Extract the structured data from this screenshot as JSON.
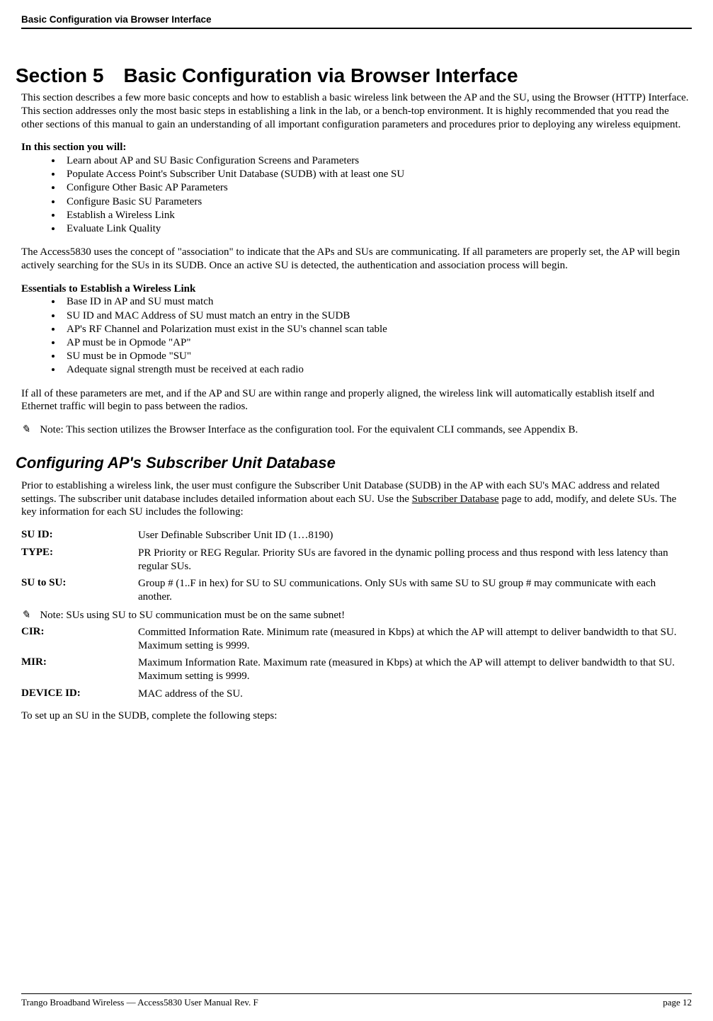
{
  "header": {
    "title": "Basic Configuration via Browser Interface"
  },
  "section": {
    "number": "Section 5",
    "title": "Basic Configuration via Browser Interface"
  },
  "intro": "This section describes a few more basic concepts and how to establish a basic wireless link between the AP and the SU, using the Browser (HTTP) Interface.  This section addresses only the most basic steps in establishing a link in the lab, or a bench-top environment.  It is highly recommended that you read the other sections of this manual to gain an understanding of all important configuration parameters and procedures prior to deploying any wireless equipment.",
  "in_this_section_label": "In this section you will:",
  "in_this_section": [
    "Learn about AP and SU Basic Configuration Screens and Parameters",
    "Populate Access Point's Subscriber Unit Database (SUDB) with at least one SU",
    "Configure Other Basic AP Parameters",
    "Configure Basic SU Parameters",
    "Establish a Wireless Link",
    "Evaluate Link Quality"
  ],
  "para2": "The Access5830 uses the concept of \"association\" to indicate that the APs and SUs are communicating.  If all parameters are properly set, the AP will begin actively searching for the SUs in its SUDB.  Once an active SU is detected, the authentication and association process will begin.",
  "essentials_label": "Essentials to Establish a Wireless Link",
  "essentials": [
    "Base ID in AP and SU must match",
    "SU ID and MAC Address of SU must match an entry in the SUDB",
    "AP's RF Channel and Polarization must exist in the SU's channel scan table",
    "AP must be in Opmode \"AP\"",
    "SU must be in Opmode \"SU\"",
    "Adequate signal strength must be received at each radio"
  ],
  "para3": "If all of these parameters are met, and if the AP and SU are within range and properly aligned, the wireless link will automatically establish itself and Ethernet traffic will begin to pass between the radios.",
  "note1_prefix": "Note:  ",
  "note1_body": "This section utilizes the Browser Interface as the configuration tool.  For the equivalent CLI commands, see Appendix B.",
  "pencil_glyph": "✎",
  "subheading": "Configuring AP's Subscriber Unit Database",
  "sudb_intro_pre": "Prior to establishing a wireless link, the user must configure the Subscriber Unit Database (SUDB) in the AP with each SU's MAC address and related settings.  The subscriber unit database includes detailed information about each SU.  Use the ",
  "sudb_intro_underline": "Subscriber Database",
  "sudb_intro_post": " page to add, modify, and delete SUs.  The key information for each SU includes the following:",
  "defs": {
    "su_id": {
      "term": "SU ID:",
      "desc": "User Definable Subscriber Unit ID (1…8190)"
    },
    "type": {
      "term": "TYPE:",
      "desc": "PR Priority or REG Regular.  Priority SUs are favored in the dynamic polling process and thus respond with less latency than regular SUs."
    },
    "su_to_su": {
      "term": "SU to SU:",
      "desc": "Group # (1..F in hex) for SU to SU communications.  Only SUs with same SU to SU group # may communicate with each another."
    },
    "cir": {
      "term": "CIR:",
      "desc": "Committed Information Rate. Minimum rate (measured in Kbps) at which the AP will attempt to deliver bandwidth to that SU.  Maximum setting is 9999."
    },
    "mir": {
      "term": "MIR:",
      "desc": "Maximum Information Rate. Maximum rate (measured in Kbps) at which the AP will attempt to deliver bandwidth to that SU.  Maximum setting is 9999."
    },
    "device_id": {
      "term": "DEVICE ID:",
      "desc": "MAC address of the SU."
    }
  },
  "note2_prefix": "Note: ",
  "note2_body": "SUs using SU to SU communication must be on the same subnet!",
  "setup_sentence": "To set up an SU in the SUDB, complete the following steps:",
  "footer": {
    "left": "Trango Broadband Wireless — Access5830 User Manual  Rev. F",
    "right": "page 12"
  }
}
